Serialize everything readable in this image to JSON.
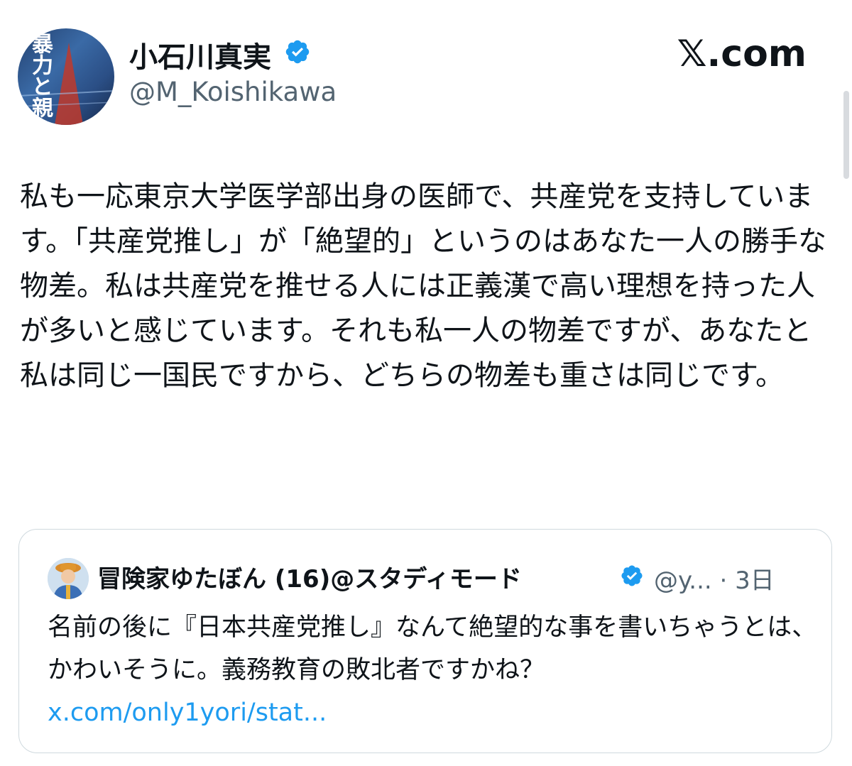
{
  "tweet": {
    "author_name": "小石川真実",
    "author_handle": "@M_Koishikawa",
    "verified_icon": "verified-badge-icon",
    "brand": "𝕏.com",
    "text": "私も一応東京大学医学部出身の医師で、共産党を支持しています。「共産党推し」が「絶望的」というのはあなた一人の勝手な物差。私は共産党を推せる人には正義漢で高い理想を持った人が多いと感じています。それも私一人の物差ですが、あなたと私は同じ一国民ですから、どちらの物差も重さは同じです。",
    "avatar_text": "暴力と親"
  },
  "quote": {
    "author_name": "冒険家ゆたぼん (16)@スタディモード",
    "handle_and_time": "@y... · 3日",
    "text": "名前の後に『日本共産党推し』なんて絶望的な事を書いちゃうとは、かわいそうに。義務教育の敗北者ですかね？",
    "link": "x.com/only1yori/stat..."
  },
  "colors": {
    "accent": "#1d9bf0",
    "secondary_text": "#536471",
    "border": "#cfd9de"
  }
}
